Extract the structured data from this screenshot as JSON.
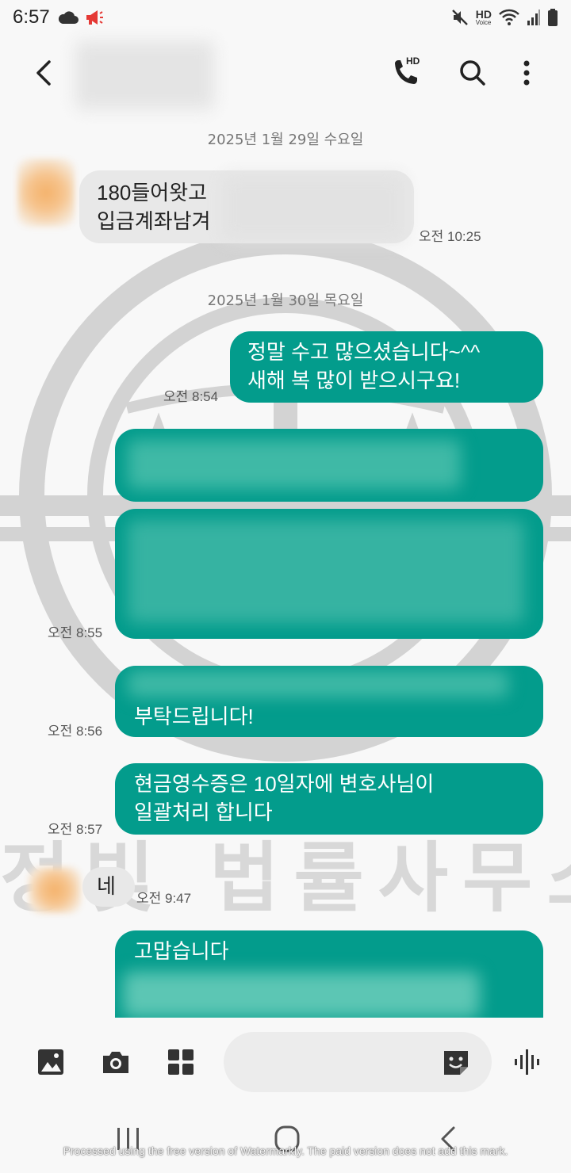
{
  "status_bar": {
    "time": "6:57",
    "hd_label": "HD",
    "voice_label": "Voice"
  },
  "header": {
    "call_hd_label": "HD"
  },
  "conversation": {
    "date_1": "2025년 1월 29일 수요일",
    "msg_in_1": {
      "line1": "180들어왓고",
      "line2": "입금계좌남겨",
      "time": "오전 10:25"
    },
    "date_2": "2025년 1월 30일 목요일",
    "msg_out_1": {
      "line1": "정말 수고 많으셨습니다~^^",
      "line2": "새해 복 많이 받으시구요!",
      "time": "오전 8:54"
    },
    "msg_out_3_time": "오전 8:55",
    "msg_out_4": {
      "line2": "부탁드립니다!",
      "time": "오전 8:56"
    },
    "msg_out_5": {
      "line1": "현금영수증은 10일자에 변호사님이",
      "line2": "일괄처리 합니다",
      "time": "오전 8:57"
    },
    "msg_in_2": {
      "text": "네",
      "time": "오전 9:47"
    },
    "msg_out_6": {
      "line1": "고맙습니다"
    }
  },
  "footer_note": "Processed using the free version of Watermarkly. The paid version does not add this mark."
}
